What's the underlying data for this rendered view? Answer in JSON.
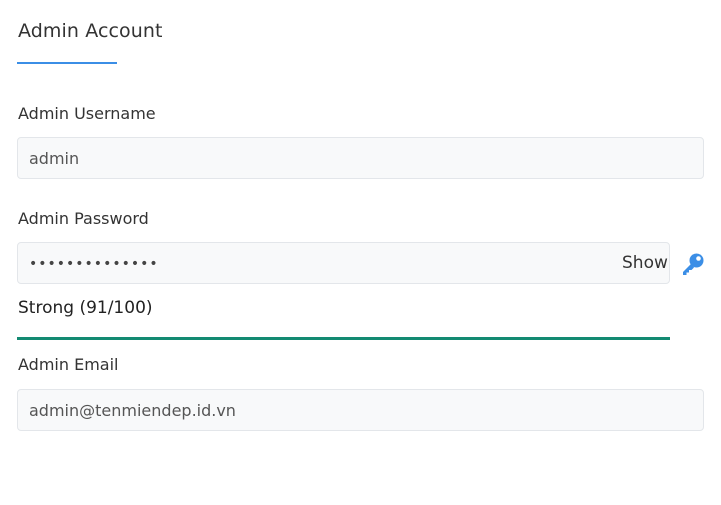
{
  "section": {
    "title": "Admin Account"
  },
  "username": {
    "label": "Admin Username",
    "value": "admin"
  },
  "password": {
    "label": "Admin Password",
    "masked_value": "••••••••••••••",
    "show_label": "Show",
    "generate_icon": "key-icon",
    "strength_text": "Strong (91/100)",
    "strength_score": 100,
    "strength_color": "#138a72"
  },
  "email": {
    "label": "Admin Email",
    "value": "admin@tenmiendep.id.vn"
  },
  "colors": {
    "accent": "#3b8ee6",
    "strength": "#138a72"
  }
}
